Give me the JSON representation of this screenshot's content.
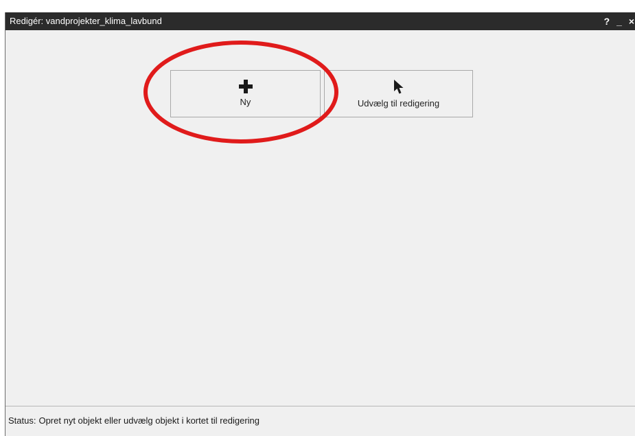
{
  "window": {
    "title": "Redigér: vandprojekter_klima_lavbund",
    "controls": {
      "help": "?",
      "minimize": "_",
      "close": "×"
    }
  },
  "toolbar": {
    "new_button": {
      "label": "Ny",
      "icon": "plus-icon"
    },
    "select_button": {
      "label": "Udvælg til redigering",
      "icon": "cursor-arrow-icon"
    }
  },
  "annotation": {
    "type": "red-ellipse",
    "color": "#e01b1b",
    "target": "new_button"
  },
  "status": {
    "label": "Status:",
    "message": "Opret nyt objekt eller udvælg objekt i kortet til redigering"
  },
  "colors": {
    "titlebar": "#2b2b2b",
    "panel": "#f0f0f0",
    "annotation": "#e01b1b"
  }
}
